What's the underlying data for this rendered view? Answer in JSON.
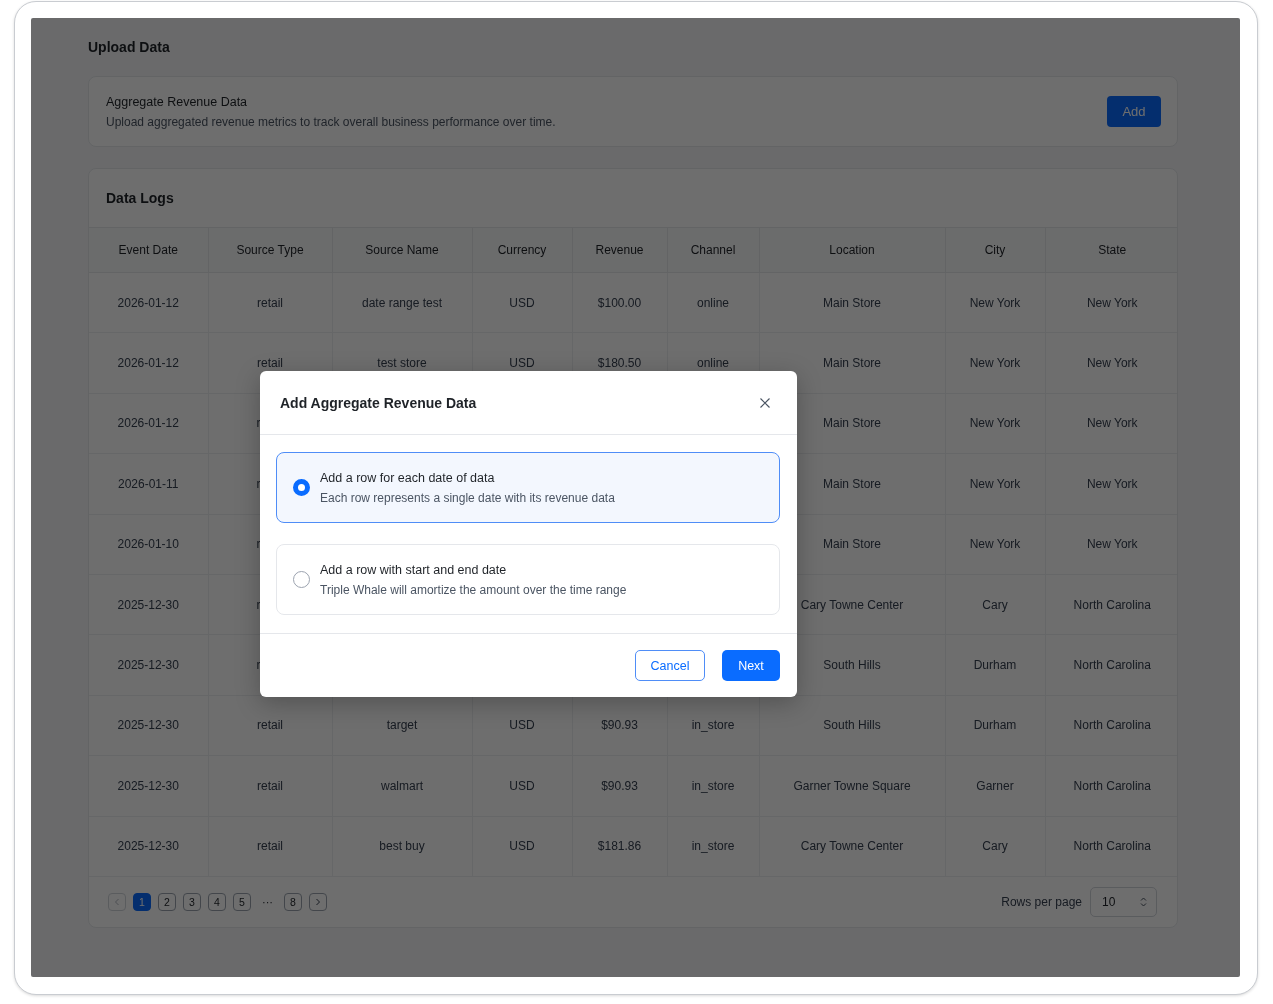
{
  "page": {
    "title": "Upload Data"
  },
  "upload_card": {
    "title": "Aggregate Revenue Data",
    "description": "Upload aggregated revenue metrics to track overall business performance over time.",
    "button": "Add"
  },
  "data_logs": {
    "title": "Data Logs",
    "columns": [
      "Event Date",
      "Source Type",
      "Source Name",
      "Currency",
      "Revenue",
      "Channel",
      "Location",
      "City",
      "State"
    ],
    "rows": [
      {
        "partial": false,
        "cells": [
          "2026-01-12",
          "retail",
          "date range test",
          "USD",
          "$100.00",
          "online",
          "Main Store",
          "New York",
          "New York"
        ]
      },
      {
        "partial": false,
        "cells": [
          "2026-01-12",
          "retail",
          "test store",
          "USD",
          "$180.50",
          "online",
          "Main Store",
          "New York",
          "New York"
        ]
      },
      {
        "partial": true,
        "cells": [
          "2026-01-12",
          "r",
          null,
          null,
          null,
          null,
          "Main Store",
          "New York",
          "New York"
        ]
      },
      {
        "partial": true,
        "cells": [
          "2026-01-11",
          "r",
          null,
          null,
          null,
          null,
          "Main Store",
          "New York",
          "New York"
        ]
      },
      {
        "partial": true,
        "cells": [
          "2026-01-10",
          "r",
          null,
          null,
          null,
          null,
          "Main Store",
          "New York",
          "New York"
        ]
      },
      {
        "partial": true,
        "cells": [
          "2025-12-30",
          "r",
          null,
          null,
          null,
          null,
          "Cary Towne Center",
          "Cary",
          "North Carolina"
        ]
      },
      {
        "partial": true,
        "cells": [
          "2025-12-30",
          "r",
          null,
          null,
          null,
          null,
          "South Hills",
          "Durham",
          "North Carolina"
        ]
      },
      {
        "partial": false,
        "cells": [
          "2025-12-30",
          "retail",
          "target",
          "USD",
          "$90.93",
          "in_store",
          "South Hills",
          "Durham",
          "North Carolina"
        ]
      },
      {
        "partial": false,
        "cells": [
          "2025-12-30",
          "retail",
          "walmart",
          "USD",
          "$90.93",
          "in_store",
          "Garner Towne Square",
          "Garner",
          "North Carolina"
        ]
      },
      {
        "partial": false,
        "cells": [
          "2025-12-30",
          "retail",
          "best buy",
          "USD",
          "$181.86",
          "in_store",
          "Cary Towne Center",
          "Cary",
          "North Carolina"
        ]
      }
    ]
  },
  "pagination": {
    "pages": [
      {
        "kind": "page",
        "label": "1",
        "selected": true
      },
      {
        "kind": "page",
        "label": "2",
        "selected": false
      },
      {
        "kind": "page",
        "label": "3",
        "selected": false
      },
      {
        "kind": "page",
        "label": "4",
        "selected": false
      },
      {
        "kind": "page",
        "label": "5",
        "selected": false
      },
      {
        "kind": "ellipsis",
        "label": "···"
      },
      {
        "kind": "page",
        "label": "8",
        "selected": false
      }
    ],
    "rows_per_page_label": "Rows per page",
    "rows_per_page": "10"
  },
  "dialog": {
    "title": "Add Aggregate Revenue Data",
    "options": [
      {
        "title": "Add a row for each date of data",
        "description": "Each row represents a single date with its revenue data",
        "selected": true
      },
      {
        "title": "Add a row with start and end date",
        "description": "Triple Whale will amortize the amount over the time range",
        "selected": false
      }
    ],
    "cancel": "Cancel",
    "next": "Next"
  }
}
